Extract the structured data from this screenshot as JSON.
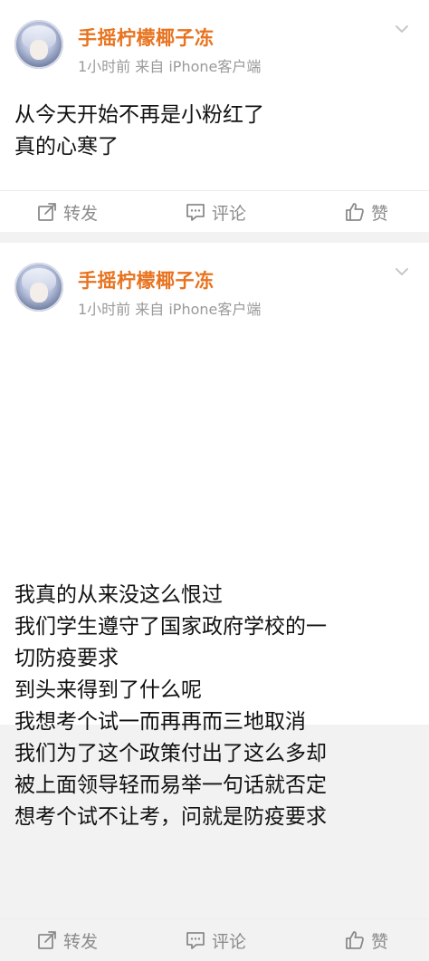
{
  "posts": [
    {
      "username": "手摇柠檬椰子冻",
      "meta": "1小时前 来自 iPhone客户端",
      "lines": [
        "从今天开始不再是小粉红了",
        "真的心寒了"
      ],
      "actions": {
        "repost": "转发",
        "comment": "评论",
        "like": "赞"
      }
    },
    {
      "username": "手摇柠檬椰子冻",
      "meta": "1小时前 来自 iPhone客户端",
      "lines": [
        "我真的从来没这么恨过",
        "我们学生遵守了国家政府学校的一",
        "切防疫要求",
        "到头来得到了什么呢",
        "我想考个试一而再再而三地取消",
        "我们为了这个政策付出了这么多却",
        "被上面领导轻而易举一句话就否定",
        "想考个试不让考，问就是防疫要求"
      ],
      "actions": {
        "repost": "转发",
        "comment": "评论",
        "like": "赞"
      }
    }
  ],
  "icons": {
    "avatar": "avatar",
    "chevron": "chevron-down-icon",
    "repost": "repost-icon",
    "comment": "comment-icon",
    "like": "thumbs-up-icon"
  },
  "colors": {
    "username": "#e8731f",
    "meta": "#9a9a9a",
    "action": "#8b8b8b",
    "background": "#f2f2f2"
  }
}
